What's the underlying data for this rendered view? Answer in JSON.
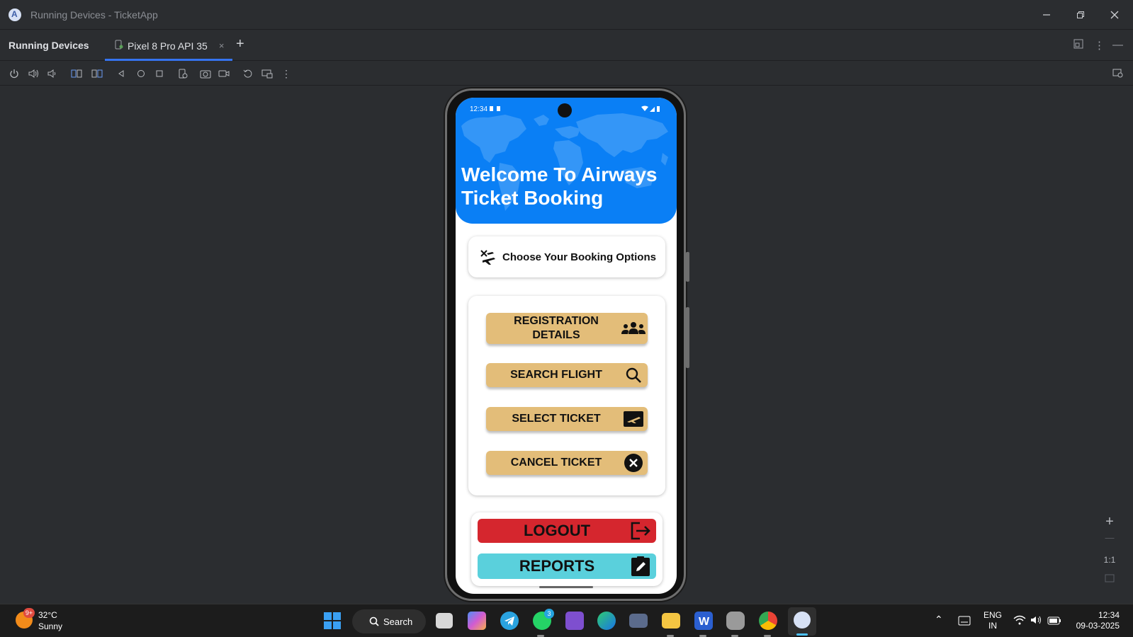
{
  "window": {
    "title": "Running Devices - TicketApp"
  },
  "panel": {
    "title": "Running Devices",
    "tab_label": "Pixel 8 Pro API 35",
    "tab_close": "×",
    "add_tab": "+"
  },
  "phone": {
    "status_time": "12:34",
    "header_title_line1": "Welcome To Airways",
    "header_title_line2": "Ticket Booking",
    "options_title": "Choose Your Booking Options",
    "menu": [
      {
        "label": "REGISTRATION DETAILS",
        "icon": "users-icon"
      },
      {
        "label": "SEARCH FLIGHT",
        "icon": "search-icon"
      },
      {
        "label": "SELECT TICKET",
        "icon": "ticket-icon"
      },
      {
        "label": "CANCEL TICKET",
        "icon": "cancel-icon"
      }
    ],
    "logout_label": "LOGOUT",
    "reports_label": "REPORTS",
    "colors": {
      "header": "#0a7ff5",
      "menu_button": "#e3bd79",
      "logout": "#d5262e",
      "reports": "#5ad0dc"
    }
  },
  "zoom": {
    "ratio": "1:1"
  },
  "taskbar": {
    "weather_badge": "9+",
    "temperature": "32°C",
    "condition": "Sunny",
    "search_label": "Search",
    "whatsapp_badge": "3",
    "language_line1": "ENG",
    "language_line2": "IN",
    "time": "12:34",
    "date": "09-03-2025"
  }
}
